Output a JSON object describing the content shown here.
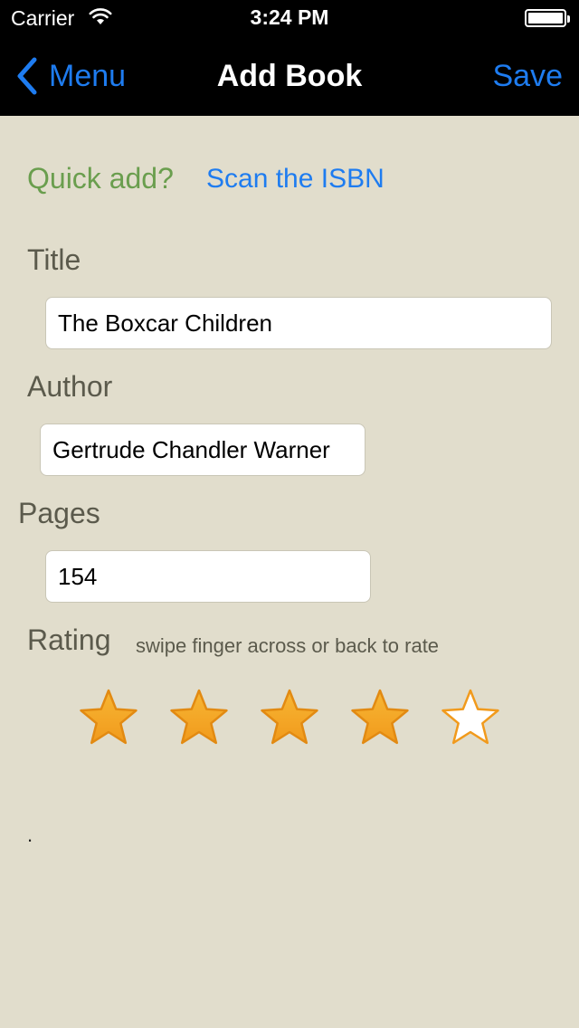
{
  "status_bar": {
    "carrier": "Carrier",
    "time": "3:24 PM"
  },
  "nav": {
    "back_label": "Menu",
    "title": "Add Book",
    "save_label": "Save"
  },
  "quick_add": {
    "prompt": "Quick add?",
    "scan_label": "Scan the ISBN"
  },
  "form": {
    "title_label": "Title",
    "title_value": "The Boxcar Children",
    "author_label": "Author",
    "author_value": "Gertrude Chandler Warner",
    "pages_label": "Pages",
    "pages_value": "154"
  },
  "rating": {
    "label": "Rating",
    "hint": "swipe finger across or back to rate",
    "value": 4,
    "max": 5,
    "filled_color": "#f19a1c",
    "empty_color": "#ffffff"
  },
  "footer_text": ".",
  "colors": {
    "accent": "#1e7cf0",
    "quick_add_green": "#6a9e4e",
    "background": "#e1ddcc"
  }
}
